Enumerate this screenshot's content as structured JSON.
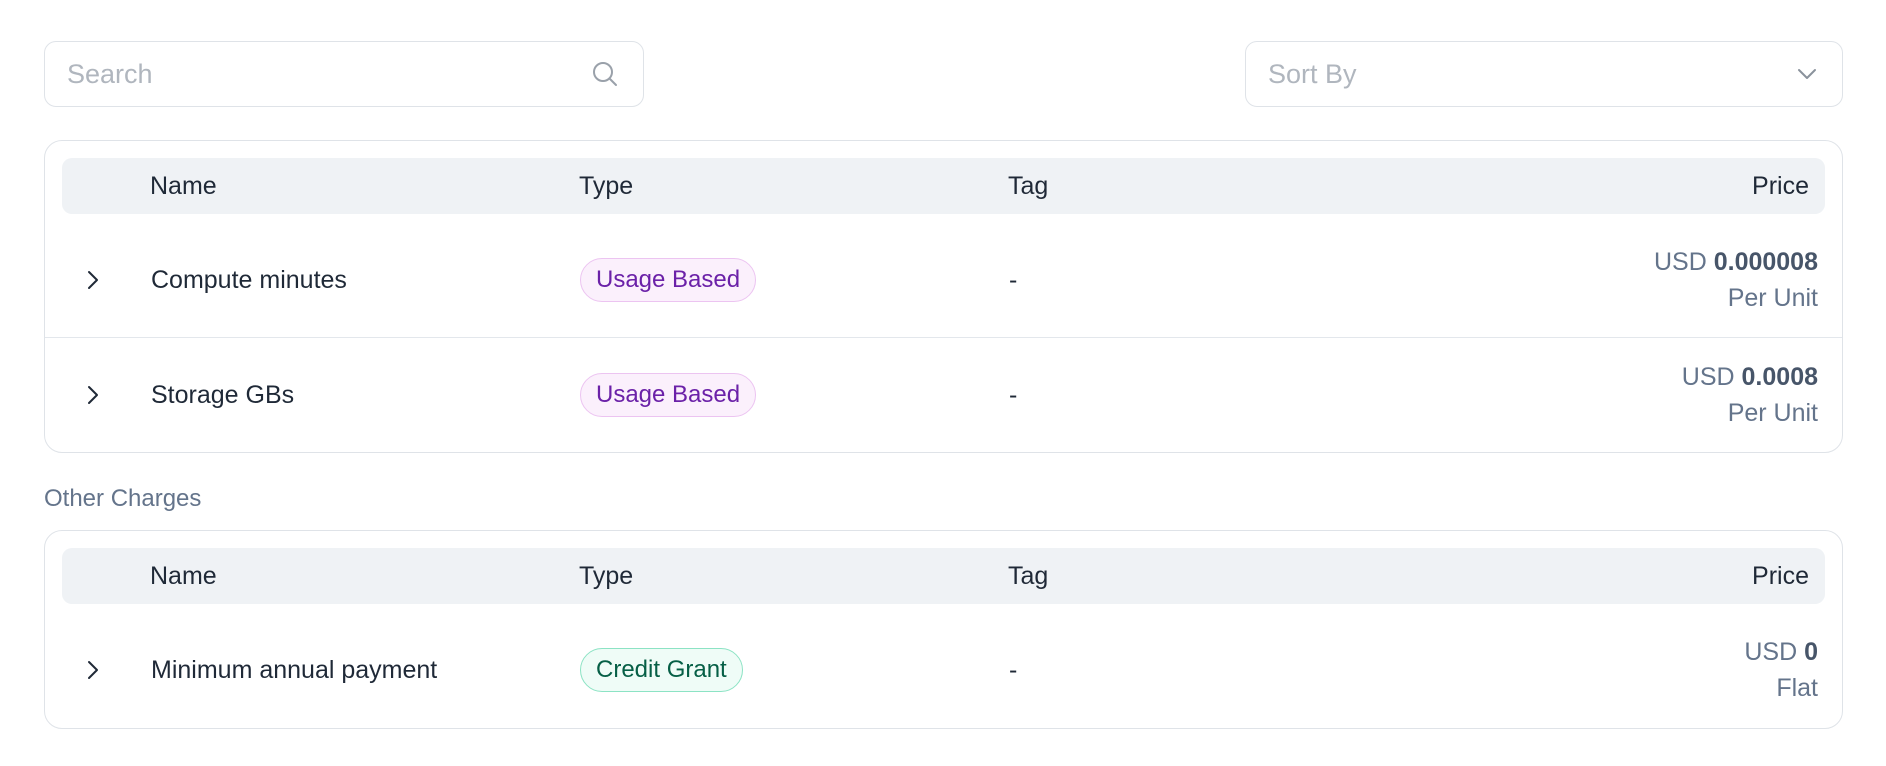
{
  "search": {
    "placeholder": "Search",
    "value": ""
  },
  "sort": {
    "label": "Sort By"
  },
  "columns": {
    "name": "Name",
    "type": "Type",
    "tag": "Tag",
    "price": "Price"
  },
  "main_table": {
    "rows": [
      {
        "name": "Compute minutes",
        "type": "Usage Based",
        "tag": "-",
        "currency": "USD",
        "amount": "0.000008",
        "unit": "Per Unit"
      },
      {
        "name": "Storage GBs",
        "type": "Usage Based",
        "tag": "-",
        "currency": "USD",
        "amount": "0.0008",
        "unit": "Per Unit"
      }
    ]
  },
  "other_charges": {
    "label": "Other Charges",
    "rows": [
      {
        "name": "Minimum annual payment",
        "type": "Credit Grant",
        "tag": "-",
        "currency": "USD",
        "amount": "0",
        "unit": "Flat"
      }
    ]
  },
  "colors": {
    "usage_badge_text": "#6b21a8",
    "usage_badge_bg": "#fbf0fc",
    "credit_badge_text": "#065f46",
    "credit_badge_bg": "#effcf7",
    "header_bg": "#eff2f5",
    "border": "#dfe3e8"
  }
}
